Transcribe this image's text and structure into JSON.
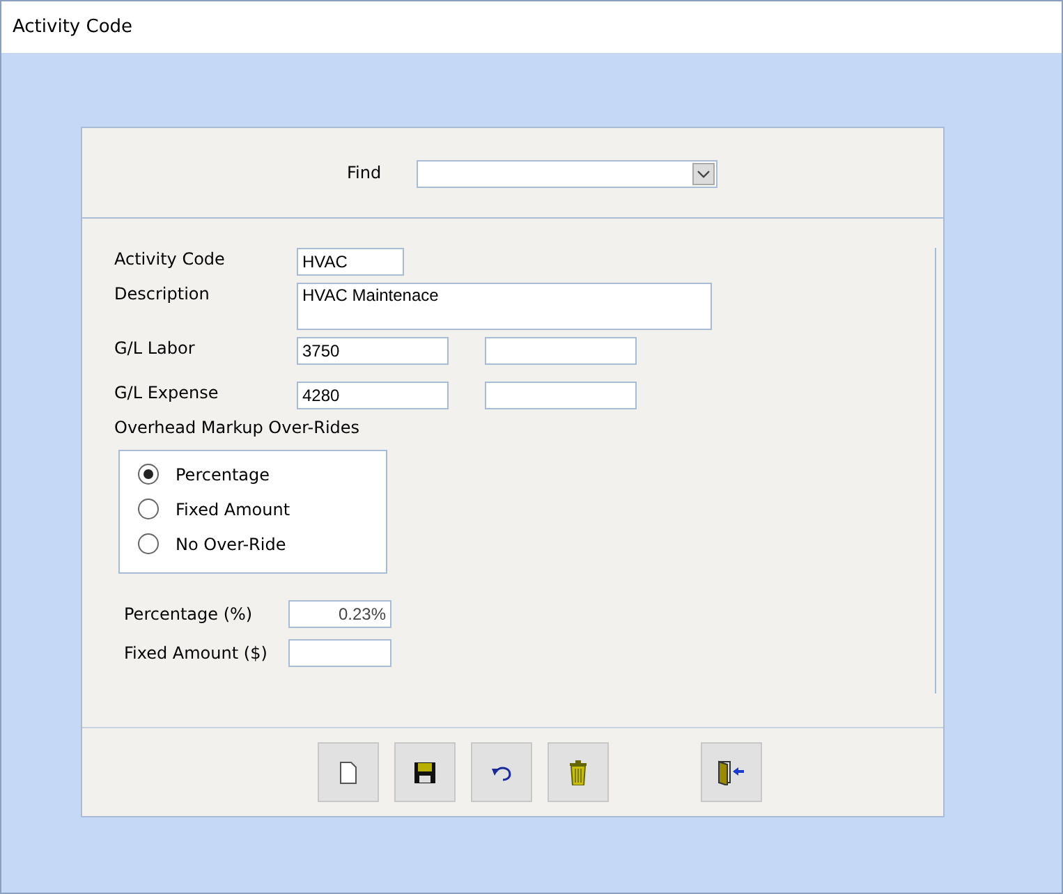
{
  "window": {
    "title": "Activity Code"
  },
  "find": {
    "label": "Find"
  },
  "fields": [
    {
      "label": "Activity Code",
      "value": "HVAC",
      "kind": "short"
    },
    {
      "label": "Description",
      "value": "HVAC Maintenace",
      "kind": "multiline"
    },
    {
      "label": "G/L Labor",
      "value": "3750",
      "kind": "pair"
    },
    {
      "label": "G/L Expense",
      "value": "4280",
      "kind": "pair"
    }
  ],
  "overhead": {
    "label": "Overhead Markup Over-Rides",
    "options": [
      {
        "label": "Percentage",
        "selected": true
      },
      {
        "label": "Fixed Amount",
        "selected": false
      },
      {
        "label": "No Over-Ride",
        "selected": false
      }
    ]
  },
  "amounts": [
    {
      "label": "Percentage (%)",
      "value": "0.23%"
    },
    {
      "label": "Fixed Amount ($)"
    }
  ],
  "toolbar": [
    {
      "kind": "new"
    },
    {
      "kind": "save"
    },
    {
      "kind": "undo"
    },
    {
      "kind": "delete"
    },
    {
      "kind": "exit"
    }
  ]
}
